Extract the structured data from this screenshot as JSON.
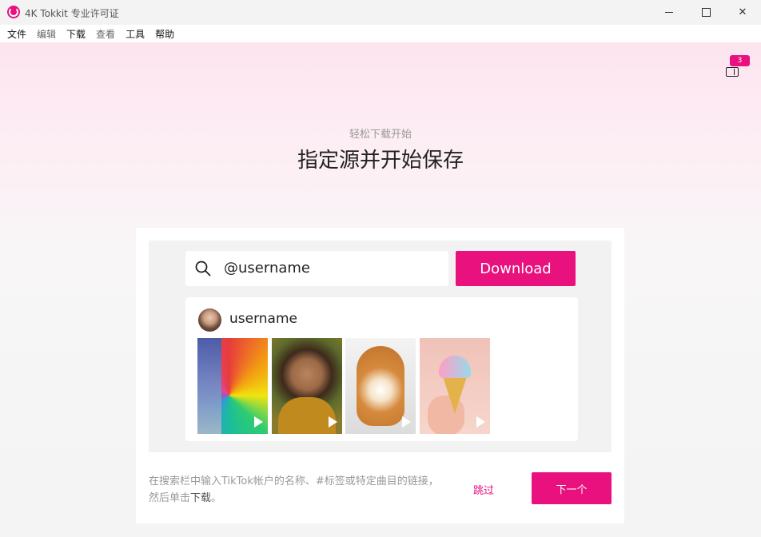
{
  "window": {
    "title": "4K Tokkit 专业许可证"
  },
  "menu": {
    "items": [
      "文件",
      "编辑",
      "下载",
      "查看",
      "工具",
      "帮助"
    ]
  },
  "queue": {
    "badge_count": "3"
  },
  "hero": {
    "subtitle": "轻松下载开始",
    "title": "指定源并开始保存"
  },
  "demo": {
    "search_value": "@username",
    "download_label": "Download",
    "result_username": "username"
  },
  "footer": {
    "hint_prefix": "在搜索栏中输入TikTok帐户的名称、#标签或特定曲目的链接，然后单击",
    "hint_emphasis": "下载",
    "hint_suffix": "。",
    "skip_label": "跳过",
    "next_label": "下一个"
  },
  "colors": {
    "accent": "#e8117d"
  }
}
